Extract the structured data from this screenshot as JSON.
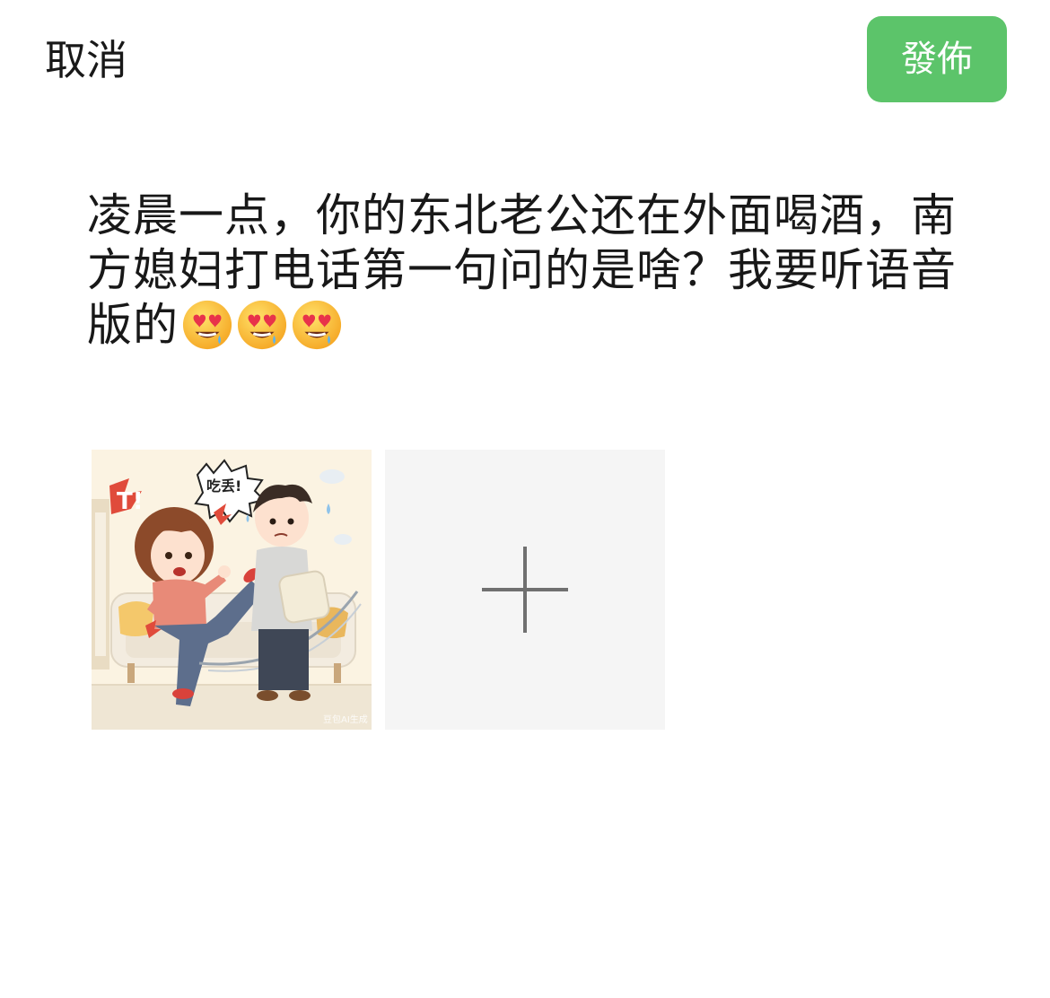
{
  "header": {
    "cancel_label": "取消",
    "publish_label": "發佈"
  },
  "post": {
    "text": "凌晨一点，你的东北老公还在外面喝酒，南方媳妇打电话第一句问的是啥？我要听语音版的",
    "emojis": [
      "heart-eyes-drooling-emoji",
      "heart-eyes-drooling-emoji",
      "heart-eyes-drooling-emoji"
    ]
  },
  "media": {
    "image": {
      "icon": "cartoon-couple-kick-image",
      "bubble_text": "吃丢!",
      "burst_text": "T!",
      "watermark": "豆包AI生成"
    },
    "add_icon": "plus-icon"
  },
  "colors": {
    "accent": "#5cc46a",
    "add_tile_bg": "#f5f5f5",
    "text": "#181818"
  }
}
